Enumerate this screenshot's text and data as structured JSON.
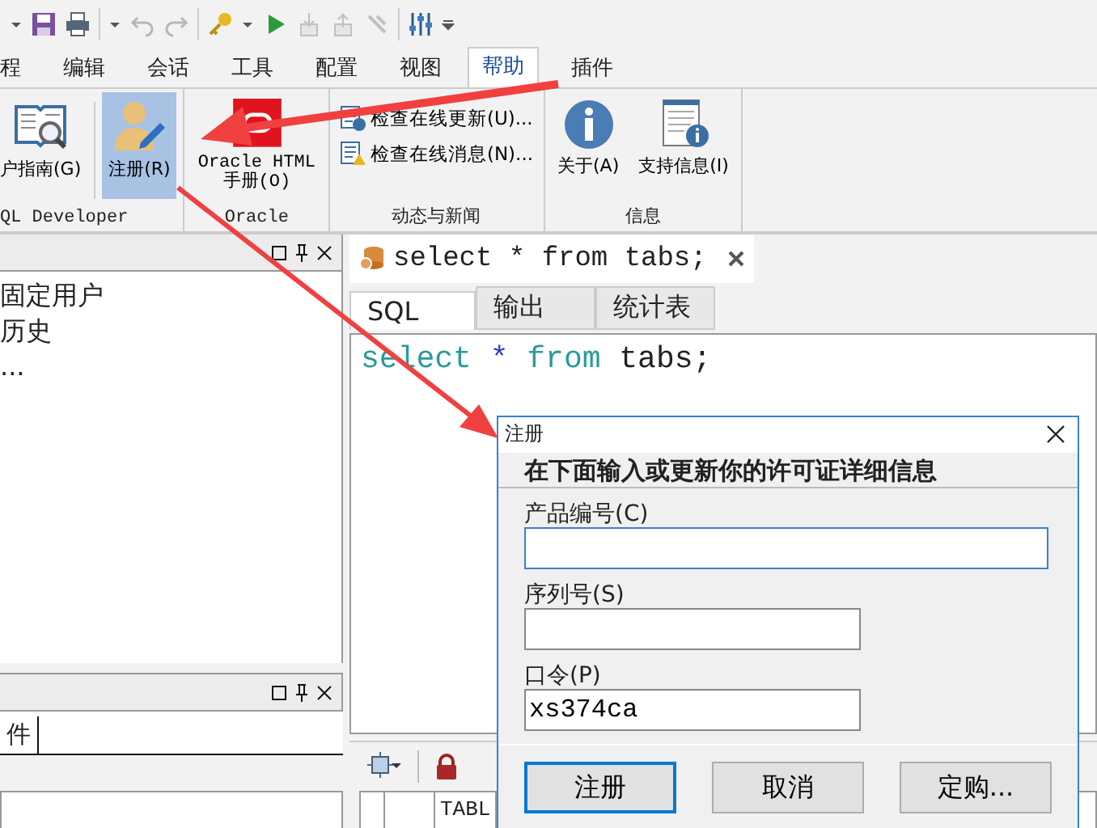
{
  "quick_toolbar": [
    {
      "kind": "dropdown",
      "disabled": false
    },
    {
      "kind": "save",
      "disabled": false
    },
    {
      "kind": "print",
      "disabled": false
    },
    {
      "kind": "dropdown",
      "disabled": false
    },
    {
      "kind": "undo",
      "disabled": true
    },
    {
      "kind": "redo",
      "disabled": true
    },
    {
      "kind": "key",
      "disabled": false
    },
    {
      "kind": "dropdown",
      "disabled": false
    },
    {
      "kind": "run",
      "disabled": false
    },
    {
      "kind": "commit",
      "disabled": true
    },
    {
      "kind": "rollback",
      "disabled": true
    },
    {
      "kind": "clear",
      "disabled": true
    },
    {
      "kind": "sliders",
      "disabled": false
    },
    {
      "kind": "more",
      "disabled": false
    }
  ],
  "menu_tabs": [
    {
      "label": "程",
      "selected": false
    },
    {
      "label": "编辑",
      "selected": false
    },
    {
      "label": "会话",
      "selected": false
    },
    {
      "label": "工具",
      "selected": false
    },
    {
      "label": "配置",
      "selected": false
    },
    {
      "label": "视图",
      "selected": false
    },
    {
      "label": "帮助",
      "selected": true
    },
    {
      "label": "插件",
      "selected": false
    }
  ],
  "ribbon_groups": [
    {
      "label": "QL Developer",
      "items": [
        {
          "kind": "book",
          "label": "户指南(G)",
          "selected": false
        },
        {
          "kind": "user",
          "label": "注册(R)",
          "selected": true
        }
      ]
    },
    {
      "label": "Oracle",
      "items": [
        {
          "kind": "oracle",
          "label": "Oracle HTML\n手册(O)",
          "selected": false
        }
      ]
    },
    {
      "label": "动态与新闻",
      "items": [
        {
          "kind": "update",
          "label": "检查在线更新(U)...",
          "selected": false
        },
        {
          "kind": "news",
          "label": "检查在线消息(N)...",
          "selected": false
        }
      ]
    },
    {
      "label": "信息",
      "items": [
        {
          "kind": "info",
          "label": "关于(A)",
          "selected": false
        },
        {
          "kind": "support",
          "label": "支持信息(I)",
          "selected": false
        }
      ]
    }
  ],
  "left_panel": {
    "items": [
      "固定用户",
      "历史",
      "..."
    ],
    "lower_tab": "件"
  },
  "editor": {
    "tab_title": "select * from tabs;",
    "subtabs": [
      {
        "label": "SQL",
        "selected": true
      },
      {
        "label": "输出",
        "selected": false
      },
      {
        "label": "统计表",
        "selected": false
      }
    ],
    "code": [
      {
        "text": "select",
        "kind": "keyword"
      },
      {
        "text": " *",
        "kind": "operator"
      },
      {
        "text": " from",
        "kind": "keyword"
      },
      {
        "text": " tabs;",
        "kind": "plain"
      }
    ],
    "grid_column": "TABL"
  },
  "dialog": {
    "title": "注册",
    "heading": "在下面输入或更新你的许可证详细信息",
    "fields": [
      {
        "label": "产品编号(C)",
        "focused": true,
        "wide": true
      },
      {
        "label": "序列号(S)",
        "focused": false,
        "wide": false
      },
      {
        "label": "口令(P)",
        "value": "xs374ca",
        "focused": false,
        "wide": false
      }
    ],
    "buttons": [
      {
        "label": "注册",
        "default": true
      },
      {
        "label": "取消",
        "default": false
      },
      {
        "label": "定购...",
        "default": false
      }
    ]
  }
}
